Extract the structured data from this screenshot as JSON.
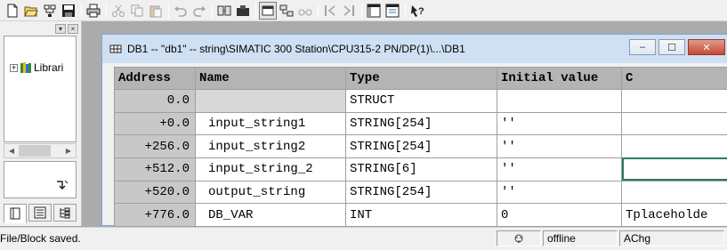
{
  "toolbar": {
    "buttons": [
      {
        "icon": "new-file-icon"
      },
      {
        "icon": "open-folder-icon"
      },
      {
        "icon": "network-open-icon"
      },
      {
        "icon": "save-icon"
      },
      {
        "icon": "print-icon"
      },
      {
        "icon": "cut-icon"
      },
      {
        "icon": "copy-icon"
      },
      {
        "icon": "paste-icon"
      },
      {
        "icon": "undo-icon"
      },
      {
        "icon": "redo-icon"
      },
      {
        "icon": "download-icon"
      },
      {
        "icon": "monitor-icon"
      },
      {
        "icon": "window-icon"
      },
      {
        "icon": "network-icon"
      },
      {
        "icon": "glasses-icon"
      },
      {
        "icon": "previous-error-icon"
      },
      {
        "icon": "next-error-icon"
      },
      {
        "icon": "overview-icon"
      },
      {
        "icon": "details-icon"
      },
      {
        "icon": "help-icon"
      }
    ]
  },
  "library_panel": {
    "tree_item_label": "Librari",
    "expand_symbol": "+",
    "panel_controls": [
      "▾",
      "×"
    ]
  },
  "db_window": {
    "title": "DB1 -- \"db1\" -- string\\SIMATIC 300 Station\\CPU315-2 PN/DP(1)\\...\\DB1",
    "controls": {
      "minimize": "–",
      "maximize": "☐",
      "close": "✕"
    }
  },
  "table": {
    "columns": [
      "Address",
      "Name",
      "Type",
      "Initial value",
      "C"
    ],
    "rows": [
      {
        "address": "0.0",
        "name": "",
        "type": "STRUCT",
        "initial": "",
        "comment": ""
      },
      {
        "address": "+0.0",
        "name": "input_string1",
        "type": "STRING[254]",
        "initial": "''",
        "comment": ""
      },
      {
        "address": "+256.0",
        "name": "input_string2",
        "type": "STRING[254]",
        "initial": "''",
        "comment": ""
      },
      {
        "address": "+512.0",
        "name": "input_string_2",
        "type": "STRING[6]",
        "initial": "''",
        "comment": ""
      },
      {
        "address": "+520.0",
        "name": "output_string",
        "type": "STRING[254]",
        "initial": "''",
        "comment": ""
      },
      {
        "address": "+776.0",
        "name": "DB_VAR",
        "type": "INT",
        "initial": "0",
        "comment": "Tplaceholde"
      }
    ]
  },
  "statusbar": {
    "message": "File/Block saved.",
    "mode": "offline",
    "change_mode": "AChg"
  }
}
